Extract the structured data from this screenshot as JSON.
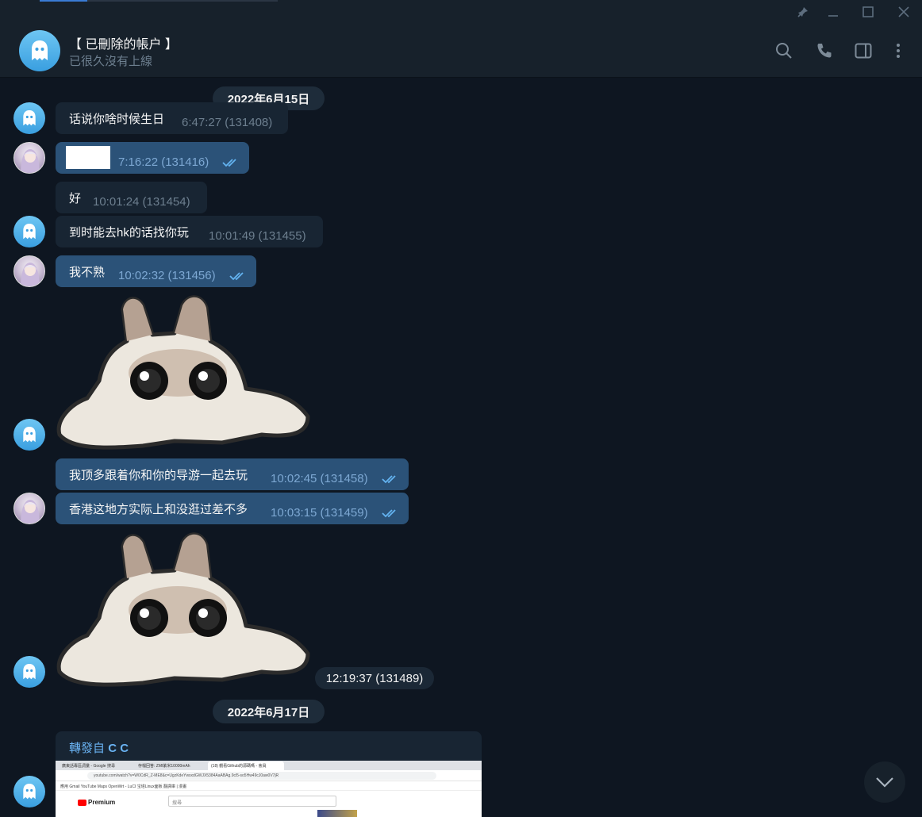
{
  "window": {
    "pin_icon": "pin-icon",
    "minimize_icon": "minimize-icon",
    "maximize_icon": "maximize-icon",
    "close_icon": "close-icon"
  },
  "header": {
    "name": "【 已刪除的帳户 】",
    "status": "已很久沒有上線",
    "avatar_icon": "ghost-icon",
    "actions": [
      "search-icon",
      "phone-icon",
      "sidebar-toggle-icon",
      "more-vertical-icon"
    ]
  },
  "dates": {
    "first": "2022年6月15日",
    "second": "2022年6月17日"
  },
  "messages": [
    {
      "direction": "in",
      "text": "话说你啥时候生日",
      "time": "6:47:27 (131408)"
    },
    {
      "direction": "out",
      "text": "",
      "redacted": true,
      "time": "7:16:22 (131416)",
      "read": true
    },
    {
      "direction": "in",
      "text": "好",
      "time": "10:01:24 (131454)"
    },
    {
      "direction": "in",
      "text": "到时能去hk的话找你玩",
      "time": "10:01:49 (131455)"
    },
    {
      "direction": "out",
      "text": "我不熟",
      "time": "10:02:32 (131456)",
      "read": true
    },
    {
      "direction": "in",
      "sticker": "cat-ghost-sticker"
    },
    {
      "direction": "out",
      "text": "我顶多跟着你和你的导游一起去玩",
      "time": "10:02:45 (131458)",
      "read": true
    },
    {
      "direction": "out",
      "text": "香港这地方实际上和没逛过差不多",
      "time": "10:03:15 (131459)",
      "read": true
    },
    {
      "direction": "in",
      "sticker": "cat-ghost-sticker",
      "time": "12:19:37 (131489)"
    }
  ],
  "forward": {
    "label_prefix": "轉發自",
    "label_source": "C C",
    "screenshot": {
      "tabs": [
        "廣東話專區詞彙 - Google 搜尋",
        "存檔回答: ZMI紫米10000mAh",
        "(18) 觀看Github的源碼嗎 - 會員"
      ],
      "url": "youtube.com/watch?v=W0CdR_Z-ME8&c=UgzKdeYwsxdGWJX5384AaABAg.9cl5-so5Hw49cJ0aw0V7jR",
      "bookmarks": "應用  Gmail  YouTube  Maps  OpenWrt - LuCI  宝塔Linux面板  翻譯庫 | 漫畫",
      "logo": "Premium",
      "search_placeholder": "搜尋"
    }
  },
  "scroll_down_icon": "chevron-down-icon"
}
